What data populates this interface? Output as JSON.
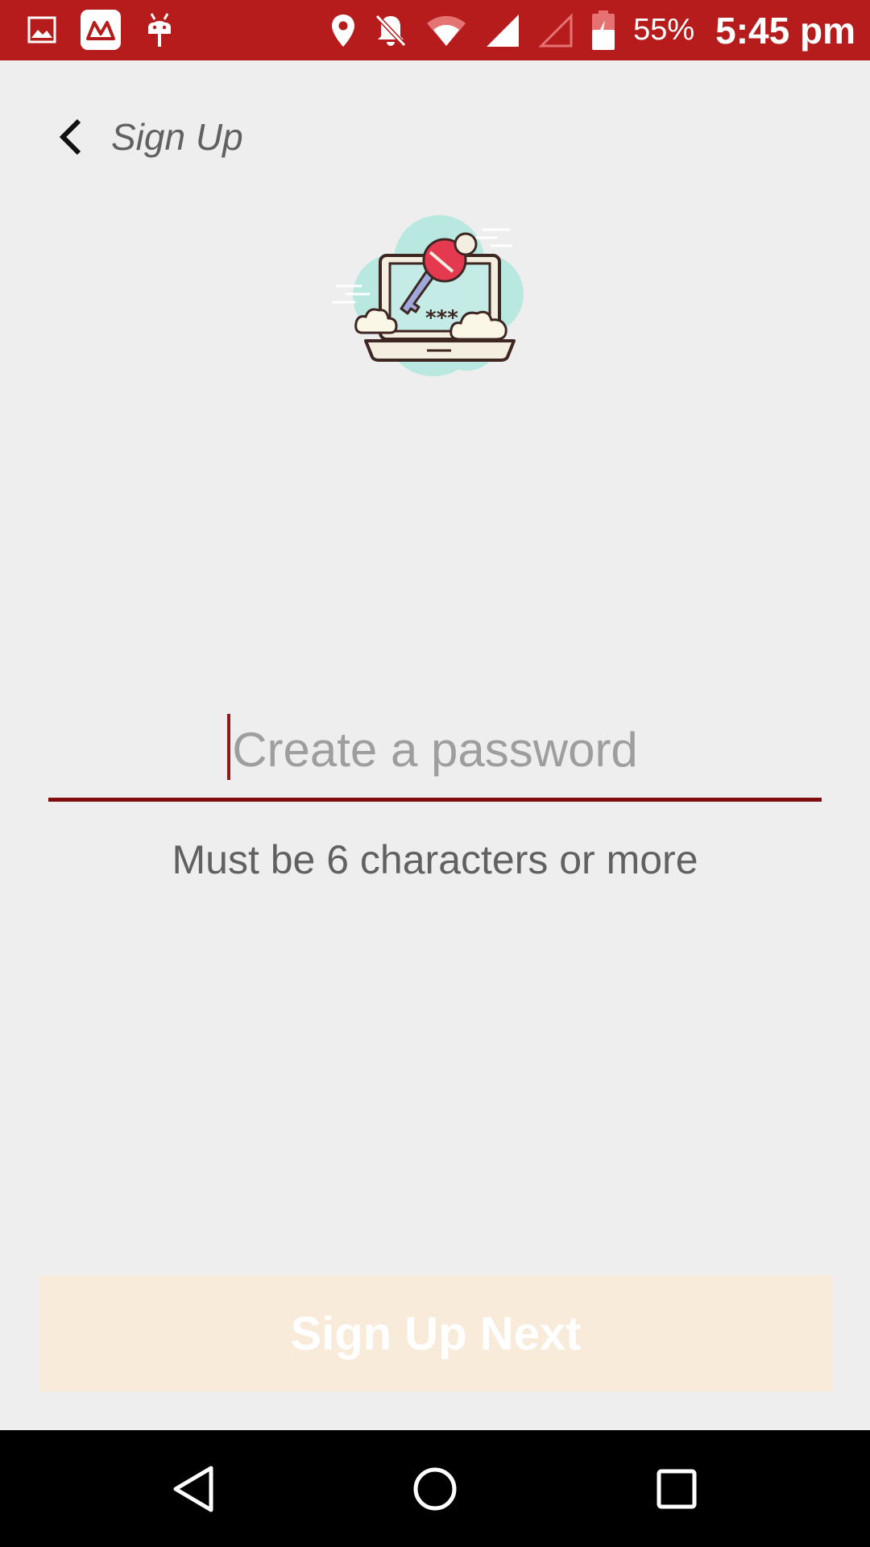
{
  "status_bar": {
    "battery_percent": "55%",
    "time": "5:45 pm",
    "icons": [
      "gallery-icon",
      "app-logo-icon",
      "android-debug-icon",
      "location-icon",
      "notifications-off-icon",
      "wifi-icon",
      "signal-icon",
      "signal-empty-icon",
      "battery-charging-icon"
    ],
    "background_color": "#b71c1c"
  },
  "header": {
    "back_icon": "chevron-left-icon",
    "title": "Sign Up"
  },
  "illustration": {
    "icon": "laptop-key-password-icon"
  },
  "password": {
    "value": "",
    "placeholder": "Create a password",
    "hint": "Must be 6 characters or more",
    "accent_color": "#7f0e0e"
  },
  "action": {
    "label": "Sign Up Next",
    "enabled": false,
    "background_color": "#f9ebd9"
  },
  "nav_bar": {
    "icons": [
      "back-triangle-icon",
      "home-circle-icon",
      "recents-square-icon"
    ]
  }
}
